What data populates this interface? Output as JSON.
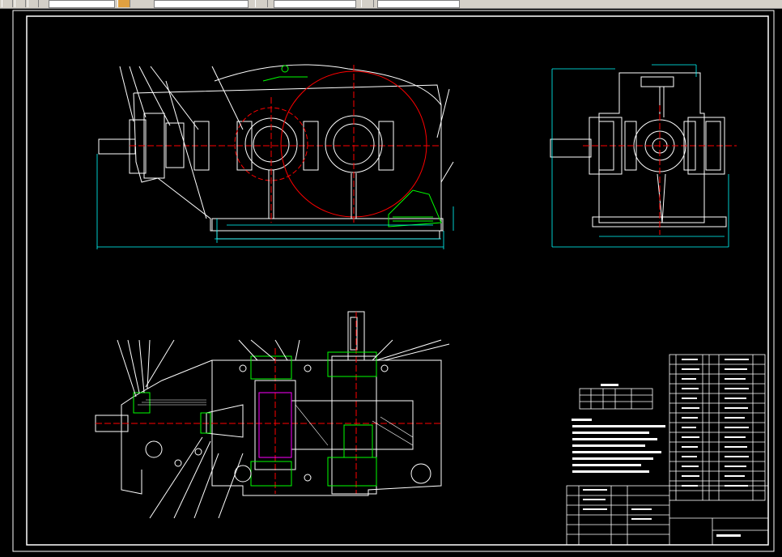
{
  "toolbar": {
    "buttons": [
      "btn1",
      "btn2",
      "btn3",
      "btn4",
      "btn5",
      "btn6"
    ]
  },
  "colors": {
    "background": "#000000",
    "lines": "#ffffff",
    "dimensions": "#00ffff",
    "centerlines": "#ff0000",
    "highlight": "#00ff00",
    "section": "#ff00ff"
  },
  "icons": {
    "toolbar_tools": "toolbar-tool-icon"
  }
}
